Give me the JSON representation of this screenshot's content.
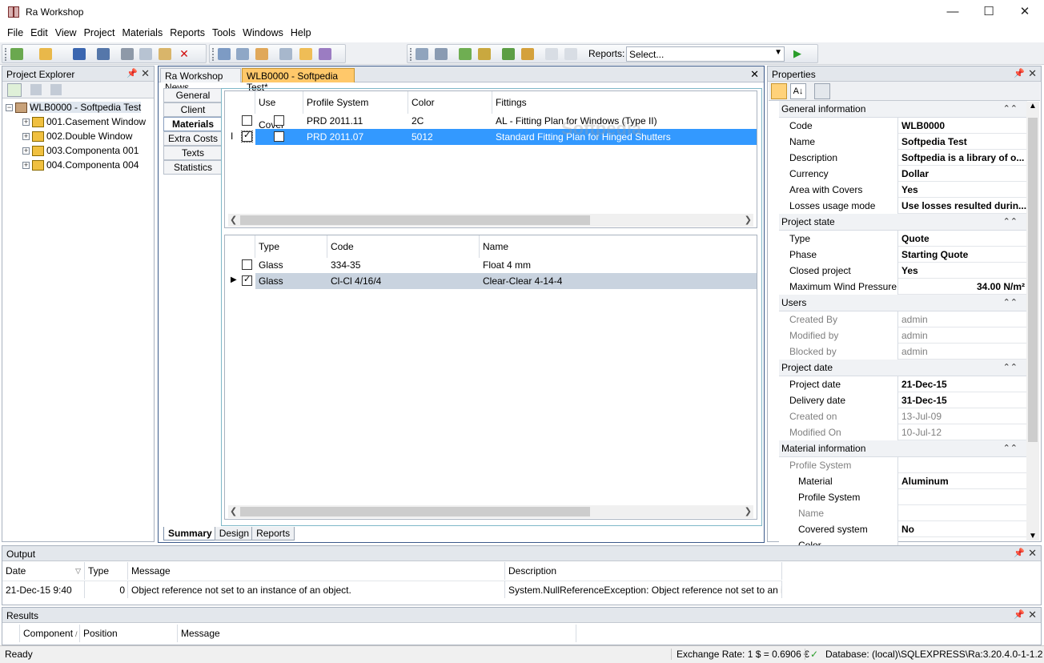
{
  "app": {
    "title": "Ra Workshop"
  },
  "window_controls": {
    "minimize": "—",
    "maximize": "☐",
    "close": "✕"
  },
  "menu": [
    "File",
    "Edit",
    "View",
    "Project",
    "Materials",
    "Reports",
    "Tools",
    "Windows",
    "Help"
  ],
  "toolbar": {
    "reports_label": "Reports:",
    "reports_value": "Select..."
  },
  "explorer": {
    "title": "Project Explorer",
    "root": "WLB0000 - Softpedia Test",
    "items": [
      "001.Casement Window",
      "002.Double Window",
      "003.Componenta 001",
      "004.Componenta 004"
    ]
  },
  "doc": {
    "tabs": [
      "Ra Workshop News",
      "WLB0000 - Softpedia Test*"
    ],
    "side_tabs": [
      "General",
      "Client",
      "Materials",
      "Extra Costs",
      "Texts",
      "Statistics"
    ],
    "bottom_tabs": [
      "Summary",
      "Design",
      "Reports"
    ],
    "grid1": {
      "columns": [
        "Use Cover",
        "Profile System",
        "Color",
        "Fittings"
      ],
      "rows": [
        {
          "profile": "PRD 2011.11",
          "color": "2C",
          "fittings": "AL - Fitting Plan for Windows (Type II)"
        },
        {
          "profile": "PRD 2011.07",
          "color": "5012",
          "fittings": "Standard Fitting Plan for Hinged Shutters"
        }
      ]
    },
    "grid2": {
      "columns": [
        "Type",
        "Code",
        "Name"
      ],
      "rows": [
        {
          "type": "Glass",
          "code": "334-35",
          "name": "Float 4 mm"
        },
        {
          "type": "Glass",
          "code": "Cl-Cl 4/16/4",
          "name": "Clear-Clear 4-14-4"
        }
      ]
    },
    "watermark": "Softpedia"
  },
  "properties": {
    "title": "Properties",
    "categories": [
      {
        "name": "General information",
        "rows": [
          {
            "k": "Code",
            "v": "WLB0000"
          },
          {
            "k": "Name",
            "v": "Softpedia Test"
          },
          {
            "k": "Description",
            "v": "Softpedia is a library of o..."
          },
          {
            "k": "Currency",
            "v": "Dollar"
          },
          {
            "k": "Area with Covers",
            "v": "Yes"
          },
          {
            "k": "Losses usage mode",
            "v": "Use losses resulted durin..."
          }
        ]
      },
      {
        "name": "Project state",
        "rows": [
          {
            "k": "Type",
            "v": "Quote"
          },
          {
            "k": "Phase",
            "v": "Starting Quote"
          },
          {
            "k": "Closed project",
            "v": "Yes"
          },
          {
            "k": "Maximum Wind Pressure",
            "v": "34.00 N/m²"
          }
        ]
      },
      {
        "name": "Users",
        "rows": [
          {
            "k": "Created By",
            "v": "admin"
          },
          {
            "k": "Modified by",
            "v": "admin"
          },
          {
            "k": "Blocked by",
            "v": "admin"
          }
        ]
      },
      {
        "name": "Project date",
        "rows": [
          {
            "k": "Project date",
            "v": "21-Dec-15"
          },
          {
            "k": "Delivery date",
            "v": "31-Dec-15"
          },
          {
            "k": "Created on",
            "v": "13-Jul-09"
          },
          {
            "k": "Modified On",
            "v": "10-Jul-12"
          }
        ]
      },
      {
        "name": "Material information",
        "rows": [
          {
            "k": "Profile System",
            "v": ""
          },
          {
            "k": "Material",
            "v": "Aluminum"
          },
          {
            "k": "Profile System",
            "v": ""
          },
          {
            "k": "Name",
            "v": ""
          },
          {
            "k": "Covered system",
            "v": "No"
          },
          {
            "k": "Color",
            "v": ""
          }
        ]
      }
    ]
  },
  "output": {
    "title": "Output",
    "columns": [
      "Date",
      "Type",
      "Message",
      "Description"
    ],
    "row": {
      "date": "21-Dec-15 9:40",
      "type": "0",
      "message": "Object reference not set to an instance of an object.",
      "description": "System.NullReferenceException: Object reference not set to an inst..."
    }
  },
  "results": {
    "title": "Results",
    "columns": [
      "Component",
      "Position",
      "Message"
    ]
  },
  "status": {
    "ready": "Ready",
    "exchange": "Exchange Rate: 1 $ = 0.6906 €",
    "database": "Database: (local)\\SQLEXPRESS\\Ra:3.20.4.0-1-1.2"
  }
}
